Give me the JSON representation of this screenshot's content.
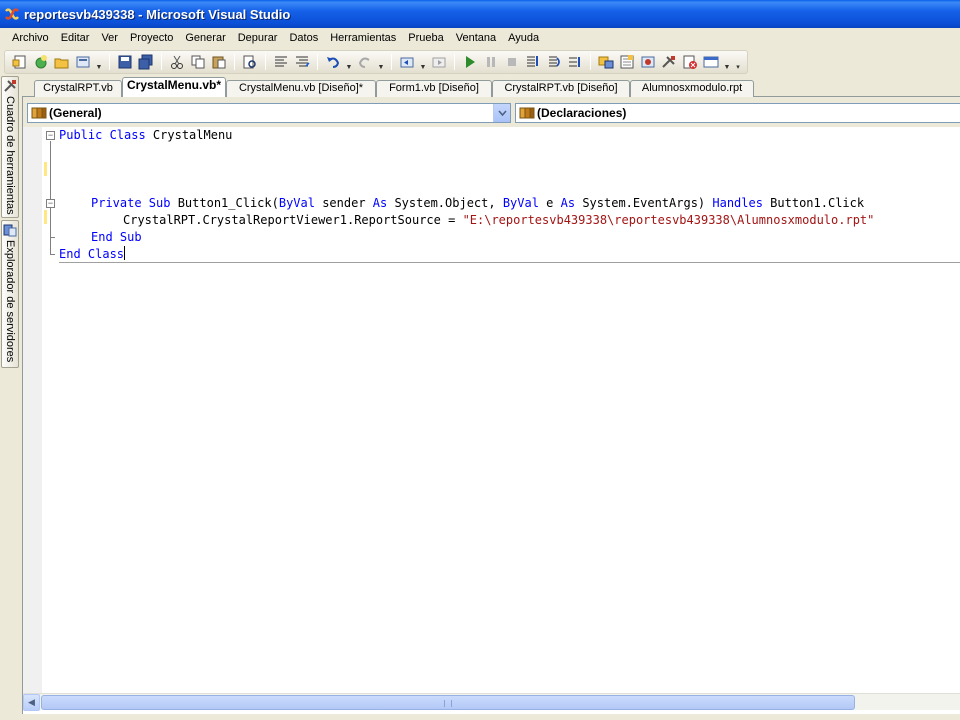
{
  "window": {
    "title": "reportesvb439338 - Microsoft Visual Studio"
  },
  "menu": [
    "Archivo",
    "Editar",
    "Ver",
    "Proyecto",
    "Generar",
    "Depurar",
    "Datos",
    "Herramientas",
    "Prueba",
    "Ventana",
    "Ayuda"
  ],
  "side_panels": [
    "Cuadro de herramientas",
    "Explorador de servidores"
  ],
  "tabs": [
    {
      "label": "CrystalRPT.vb",
      "active": false
    },
    {
      "label": "CrystalMenu.vb*",
      "active": true
    },
    {
      "label": "CrystalMenu.vb [Diseño]*",
      "active": false
    },
    {
      "label": "Form1.vb [Diseño]",
      "active": false
    },
    {
      "label": "CrystalRPT.vb [Diseño]",
      "active": false
    },
    {
      "label": "Alumnosxmodulo.rpt",
      "active": false
    }
  ],
  "nav": {
    "class_combo": "(General)",
    "member_combo": "(Declaraciones)"
  },
  "code": {
    "l1_kw": "Public Class",
    "l1_name": " CrystalMenu",
    "l4_kw1": "Private Sub",
    "l4_name": " Button1_Click(",
    "l4_kw2": "ByVal",
    "l4_t1": " sender ",
    "l4_kw3": "As",
    "l4_t2": " System.Object, ",
    "l4_kw4": "ByVal",
    "l4_t3": " e ",
    "l4_kw5": "As",
    "l4_t4": " System.EventArgs) ",
    "l4_kw6": "Handles",
    "l4_t5": " Button1.Click",
    "l5_text": "CrystalRPT.CrystalReportViewer1.ReportSource = ",
    "l5_str": "\"E:\\reportesvb439338\\reportesvb439338\\Alumnosxmodulo.rpt\"",
    "l6_kw": "End Sub",
    "l7_kw": "End Class"
  }
}
